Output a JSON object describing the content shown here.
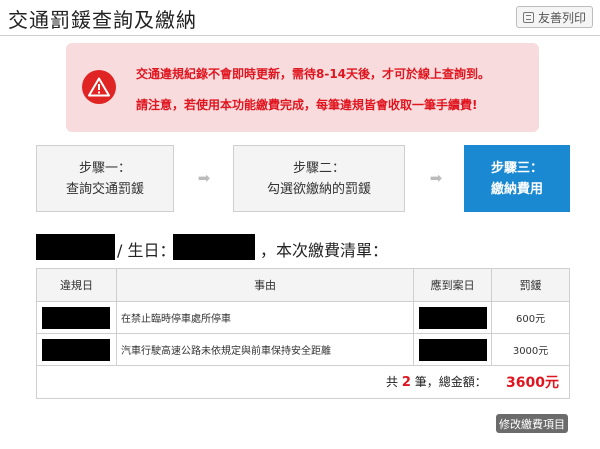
{
  "header": {
    "title": "交通罰鍰查詢及繳納",
    "print_label": "友善列印"
  },
  "alert": {
    "line1": "交通違規紀錄不會即時更新，需待8-14天後，才可於線上查詢到。",
    "line2": "請注意，若使用本功能繳費完成，每筆違規皆會收取一筆手續費!"
  },
  "steps": [
    {
      "title": "步驟一：",
      "label": "查詢交通罰鍰"
    },
    {
      "title": "步驟二：",
      "label": "勾選欲繳納的罰鍰"
    },
    {
      "title": "步驟三：",
      "label": "繳納費用"
    }
  ],
  "summary": {
    "birth_label": "/ 生日：",
    "suffix": "，本次繳費清單："
  },
  "table": {
    "headers": [
      "違規日",
      "事由",
      "應到案日",
      "罰鍰"
    ],
    "rows": [
      {
        "reason": "在禁止臨時停車處所停車",
        "amount": "600元"
      },
      {
        "reason": "汽車行駛高速公路未依規定與前車保持安全距離",
        "amount": "3000元"
      }
    ],
    "total_prefix": "共",
    "total_count": "2",
    "total_middle": "筆，總金額：",
    "total_amount": "3600元"
  },
  "actions": {
    "modify_label": "修改繳費項目"
  },
  "colors": {
    "accent": "#1a89d1",
    "alert_text": "#e0151f",
    "alert_bg": "#f8dcdd"
  }
}
